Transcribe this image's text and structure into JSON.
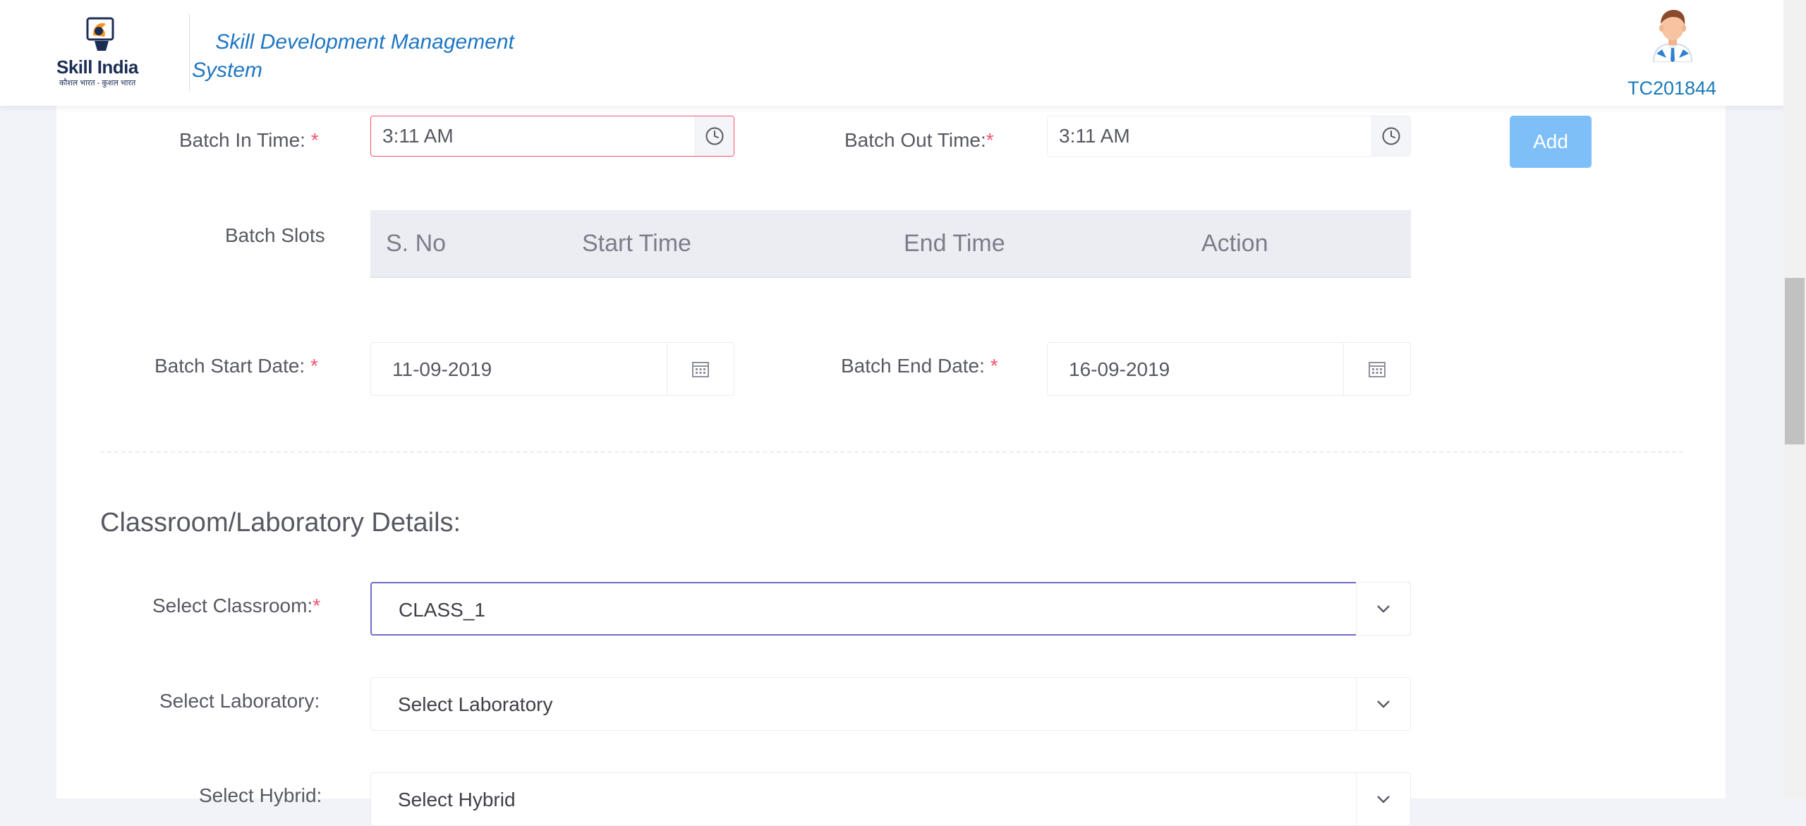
{
  "header": {
    "logo_main": "Skill India",
    "logo_sub": "कौशल भारत - कुशल भारत",
    "title": "Skill Development Management System",
    "user_id": "TC201844"
  },
  "timing": {
    "batch_in_label": "Batch In Time: ",
    "batch_in_value": "3:11 AM",
    "batch_out_label": "Batch Out Time:",
    "batch_out_value": "3:11 AM",
    "required_mark": "*",
    "add_button": "Add"
  },
  "slots": {
    "label": "Batch Slots",
    "columns": [
      "S. No",
      "Start Time",
      "End Time",
      "Action"
    ],
    "rows": []
  },
  "dates": {
    "start_label": "Batch Start Date: ",
    "start_value": "11-09-2019",
    "end_label": "Batch End Date: ",
    "end_value": "16-09-2019"
  },
  "classroom": {
    "section_title": "Classroom/Laboratory Details:",
    "classroom_label": "Select Classroom:",
    "classroom_value": "CLASS_1",
    "laboratory_label": "Select Laboratory:",
    "laboratory_value": "Select Laboratory",
    "hybrid_label": "Select Hybrid:",
    "hybrid_value": "Select Hybrid"
  },
  "icons": {
    "clock": "clock-icon",
    "calendar": "calendar-icon",
    "chevron": "chevron-down-icon",
    "avatar": "user-avatar-icon"
  },
  "colors": {
    "accent_blue": "#1f76c2",
    "add_button": "#7fbff8",
    "required": "#f4516c",
    "focus_border": "#716aca",
    "table_header_bg": "#ebedf2"
  }
}
